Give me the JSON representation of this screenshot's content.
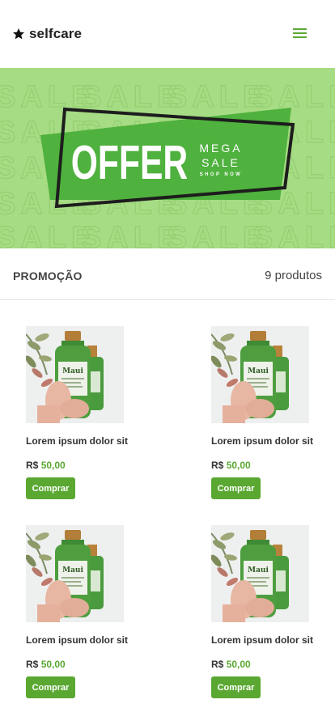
{
  "header": {
    "brand_name": "selfcare",
    "brand_icon": "star-icon",
    "menu_icon": "hamburger-menu-icon",
    "accent_color": "#5aa832"
  },
  "banner": {
    "background_word": "SALE",
    "headline": "OFFER",
    "line1": "MEGA",
    "line2": "SALE",
    "line3": "SHOP NOW",
    "bg_color": "#a6dc84",
    "card_color": "#4fb13e"
  },
  "section": {
    "title": "PROMOÇÃO",
    "count": "9 produtos"
  },
  "products": [
    {
      "name": "Lorem ipsum dolor sit",
      "currency": "R$",
      "price": "50,00",
      "button": "Comprar",
      "bottle_label": "Maui"
    },
    {
      "name": "Lorem ipsum dolor sit",
      "currency": "R$",
      "price": "50,00",
      "button": "Comprar",
      "bottle_label": "Maui"
    },
    {
      "name": "Lorem ipsum dolor sit",
      "currency": "R$",
      "price": "50,00",
      "button": "Comprar",
      "bottle_label": "Maui"
    },
    {
      "name": "Lorem ipsum dolor sit",
      "currency": "R$",
      "price": "50,00",
      "button": "Comprar",
      "bottle_label": "Maui"
    }
  ]
}
